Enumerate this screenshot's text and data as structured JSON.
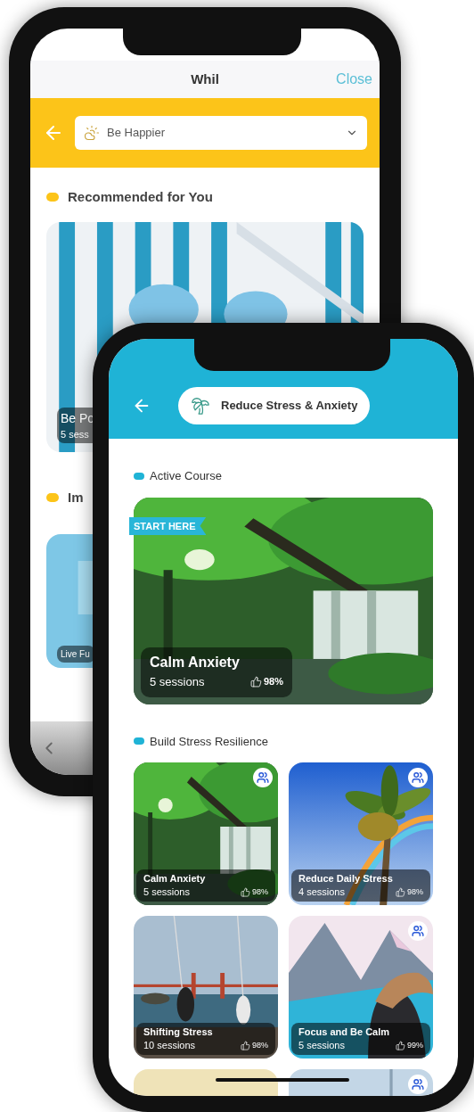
{
  "back_screen": {
    "title": "Whil",
    "close": "Close",
    "selector": {
      "value": "Be Happier"
    },
    "sections": [
      {
        "heading": "Recommended for You",
        "cards": [
          {
            "title": "Be Po",
            "sessions": "5 sess"
          }
        ]
      },
      {
        "heading": "Im",
        "cards": [
          {
            "title": "Live Fu"
          }
        ]
      }
    ]
  },
  "front_screen": {
    "topic": "Reduce Stress & Anxiety",
    "active": {
      "heading": "Active Course",
      "ribbon": "START HERE",
      "title": "Calm Anxiety",
      "sessions": "5 sessions",
      "rating": "98%"
    },
    "section": {
      "heading": "Build Stress Resilience",
      "cards": [
        {
          "title": "Calm Anxiety",
          "sessions": "5 sessions",
          "rating": "98%",
          "group": true
        },
        {
          "title": "Reduce Daily Stress",
          "sessions": "4 sessions",
          "rating": "98%",
          "group": true
        },
        {
          "title": "Shifting Stress",
          "sessions": "10 sessions",
          "rating": "98%",
          "group": false
        },
        {
          "title": "Focus and Be Calm",
          "sessions": "5 sessions",
          "rating": "99%",
          "group": true
        },
        {
          "group": false
        },
        {
          "group": true
        }
      ]
    }
  }
}
